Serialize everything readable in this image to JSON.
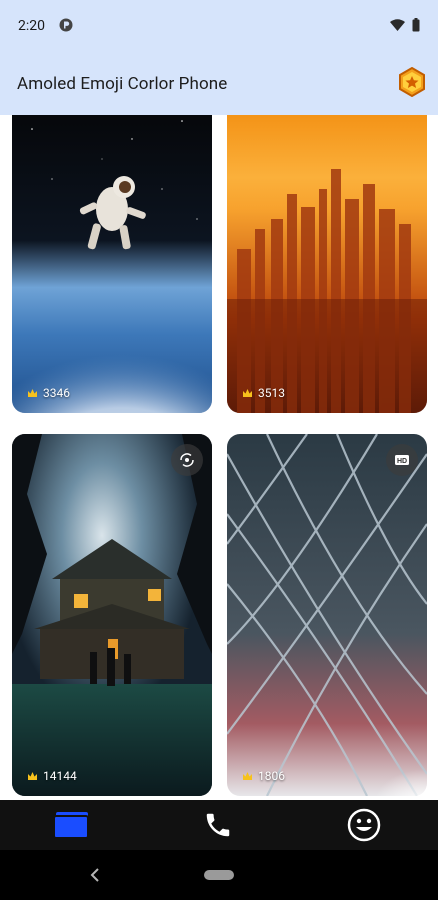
{
  "status_bar": {
    "time": "2:20"
  },
  "app_bar": {
    "title": "Amoled Emoji Corlor Phone"
  },
  "cards": [
    {
      "count": "3346",
      "subject": "astronaut-over-earth"
    },
    {
      "count": "3513",
      "subject": "city-skyline-sunset"
    },
    {
      "count": "14144",
      "subject": "haunted-house",
      "badge": "live-rotate-icon"
    },
    {
      "count": "1806",
      "subject": "glass-roof-architecture",
      "badge": "hd-icon"
    }
  ],
  "bottom_nav": {
    "items": [
      {
        "icon": "wallpapers-icon",
        "active": true
      },
      {
        "icon": "phone-icon",
        "active": false
      },
      {
        "icon": "emoji-icon",
        "active": false
      }
    ]
  },
  "colors": {
    "app_bar": "#d6e4fb",
    "active_nav": "#1a4dff",
    "bottom_nav": "#111111"
  }
}
